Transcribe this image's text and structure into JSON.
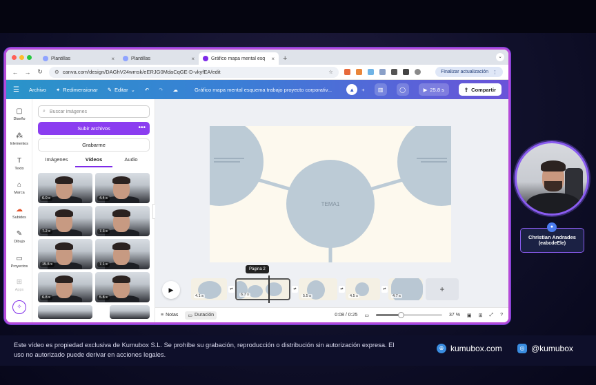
{
  "browser": {
    "tabs": [
      {
        "label": "Plantillas",
        "active": false
      },
      {
        "label": "Plantillas",
        "active": false
      },
      {
        "label": "Gráfico mapa mental esq",
        "active": true
      }
    ],
    "url": "canva.com/design/DAGhV24wmsk/eERJG0MdaCqGE-D-vkyfEA/edit",
    "update_label": "Finalizar actualización"
  },
  "toolbar": {
    "file": "Archivo",
    "resize": "Redimensionar",
    "edit": "Editar",
    "doc_title": "Gráfico mapa mental esquema trabajo proyecto corporativ...",
    "duration": "25.8 s",
    "share": "Compartir"
  },
  "rail": [
    {
      "label": "Diseño",
      "icon": "layout-icon"
    },
    {
      "label": "Elementos",
      "icon": "elements-icon"
    },
    {
      "label": "Texto",
      "icon": "text-icon"
    },
    {
      "label": "Marca",
      "icon": "brand-icon"
    },
    {
      "label": "Subidos",
      "icon": "uploads-icon"
    },
    {
      "label": "Dibujo",
      "icon": "draw-icon"
    },
    {
      "label": "Proyectos",
      "icon": "folder-icon"
    },
    {
      "label": "Apps",
      "icon": "apps-icon"
    }
  ],
  "panel": {
    "search_placeholder": "Buscar imágenes",
    "upload": "Subir archivos",
    "record": "Grabarme",
    "tabs": [
      "Imágenes",
      "Vídeos",
      "Audio"
    ],
    "active_tab": "Vídeos",
    "videos": [
      "6.0 s",
      "4.4 s",
      "7.2 s",
      "7.3 s",
      "15.5 s",
      "7.1 s",
      "6.8 s",
      "5.8 s"
    ]
  },
  "slide": {
    "center": "TEMA1"
  },
  "timeline": {
    "tooltip": "Página 2",
    "clips": [
      "4.1 s",
      "6.7 s",
      "5.5 s",
      "4.5 s",
      "4.7 s"
    ]
  },
  "bottombar": {
    "notes": "Notas",
    "duration": "Duración",
    "time": "0:08 / 0:25",
    "zoom": "37 %",
    "zoom_level": 0.37
  },
  "presenter": {
    "name": "Christian Andrades",
    "handle": "(eabcdeEle)"
  },
  "footer": {
    "legal": "Este vídeo es propiedad exclusiva de Kumubox S.L. Se prohíbe su grabación, reproducción o distribución sin autorización expresa. El uso no autorizado puede derivar en acciones legales.",
    "site": "kumubox.com",
    "instagram": "@kumubox"
  },
  "colors": {
    "accent": "#7d2ae8",
    "toolbar_start": "#2a94c9",
    "toolbar_end": "#6a53d9",
    "circle": "#bccbd6",
    "slide_bg": "#fdf9ee"
  }
}
